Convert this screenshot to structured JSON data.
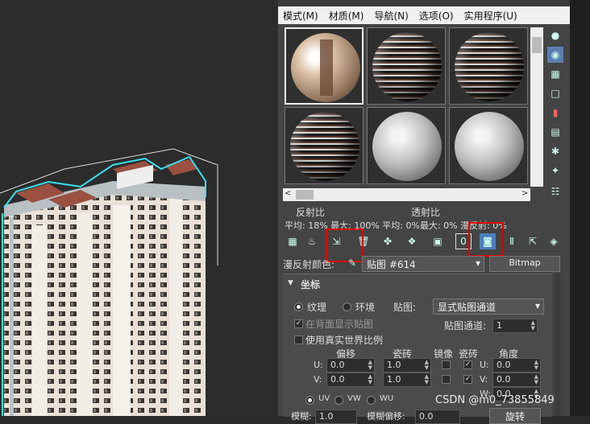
{
  "menu": {
    "items": [
      "模式(M)",
      "材质(M)",
      "导航(N)",
      "选项(O)",
      "实用程序(U)"
    ]
  },
  "stats": {
    "reflect_label": "反射比",
    "transmit_label": "透射比",
    "row": "平均:  18% 最大:  100%     平均:    0%最大:    0% 漫反射:    0%"
  },
  "diffuse": {
    "label": "漫反射颜色:",
    "map_name": "贴图 #614",
    "map_type": "Bitmap"
  },
  "coords": {
    "title": "坐标",
    "texture": "纹理",
    "environ": "环境",
    "mapping_label": "贴图:",
    "mapping_value": "显式贴图通道",
    "show_back": "在背面显示贴图",
    "channel_label": "贴图通道:",
    "channel_value": "1",
    "real_world": "使用真实世界比例",
    "col_offset": "偏移",
    "col_tiling": "瓷砖",
    "col_mirror": "镜像",
    "col_tile": "瓷砖",
    "col_angle": "角度",
    "u_label": "U:",
    "v_label": "V:",
    "w_label": "W:",
    "u_offset": "0.0",
    "u_tiling": "1.0",
    "u_angle": "0.0",
    "v_offset": "0.0",
    "v_tiling": "1.0",
    "v_angle": "0.0",
    "w_angle": "0.0",
    "uv": "UV",
    "vw": "VW",
    "wu": "WU",
    "blur": "模糊:",
    "blur_value": "1.0",
    "blur_offset": "模糊偏移:",
    "blur_offset_value": "0.0",
    "rotate": "旋转"
  },
  "watermark": "CSDN @m0_73855849",
  "colors": {
    "highlight": "#e00000",
    "menubar": "#f0f0f0",
    "panel": "#444444"
  }
}
